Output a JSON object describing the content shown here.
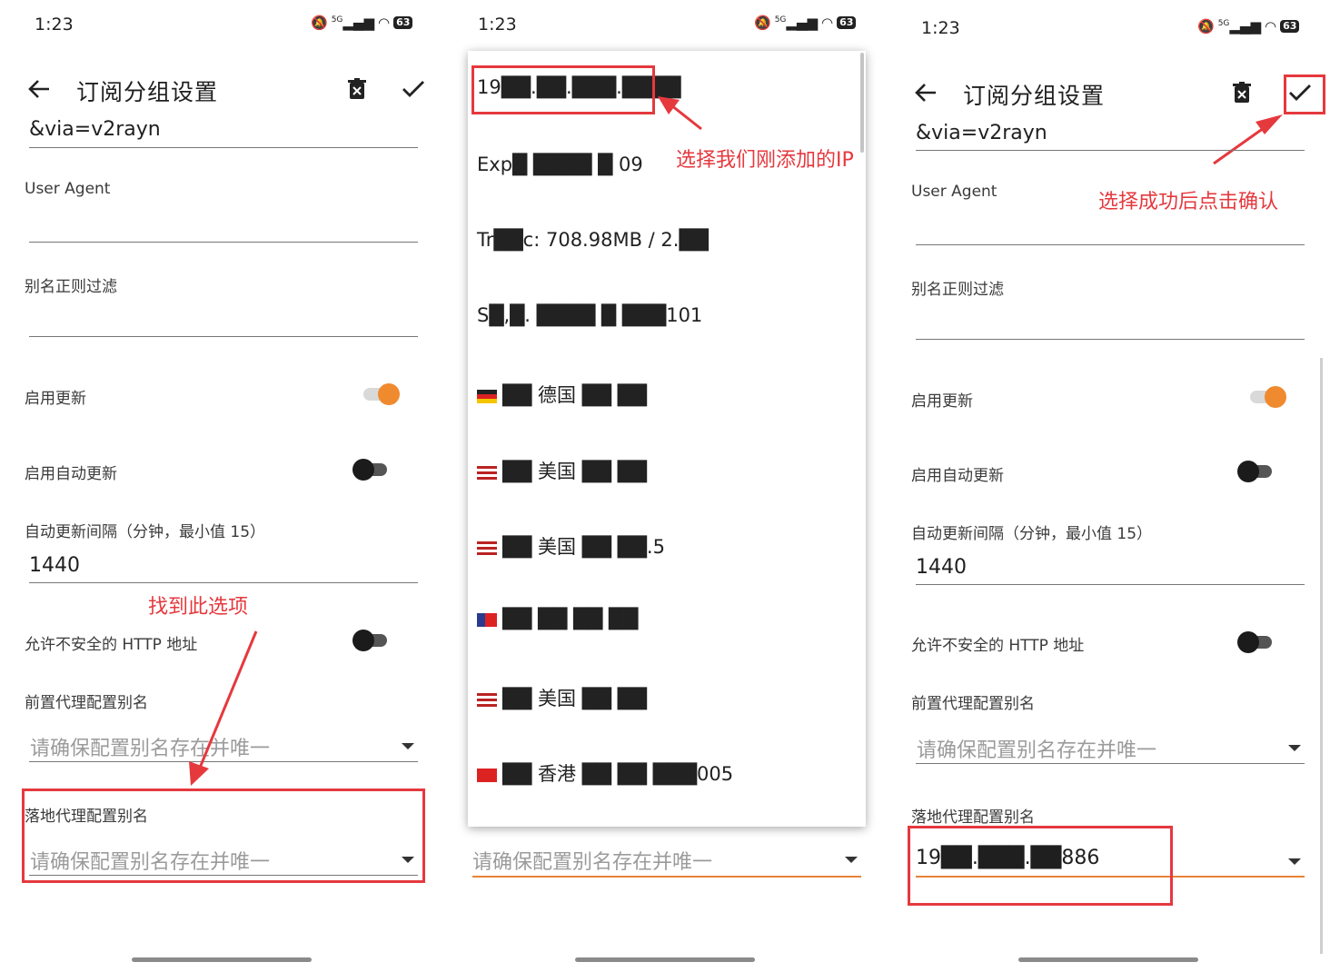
{
  "status": {
    "time": "1:23",
    "signal": "5G",
    "battery": "63"
  },
  "appbar": {
    "title": "订阅分组设置"
  },
  "form": {
    "url_tail": "&via=v2rayn",
    "user_agent_label": "User Agent",
    "alias_filter_label": "别名正则过滤",
    "enable_update_label": "启用更新",
    "enable_update": true,
    "auto_update_label": "启用自动更新",
    "auto_update": false,
    "interval_label": "自动更新间隔（分钟，最小值 15）",
    "interval_value": "1440",
    "insecure_http_label": "允许不安全的 HTTP 地址",
    "insecure_http": false,
    "prev_proxy_label": "前置代理配置别名",
    "prev_proxy_placeholder": "请确保配置别名存在并唯一",
    "next_proxy_label": "落地代理配置别名",
    "next_proxy_placeholder": "请确保配置别名存在并唯一",
    "next_proxy_selected": "19██.███.██886"
  },
  "popup": {
    "items": [
      "19██.██.███.████",
      "Exp█ ████ █ 09",
      "Tr██c: 708.98MB / 2.██",
      "S█,█. ████ █ ███101",
      "██ 德国 ██ ██",
      "██ 美国 ██ ██",
      "██ 美国 ██ ██.5",
      "██ ██ ██ ██",
      "██ 美国 ██ ██",
      "██ 香港 ██ ██ ███005"
    ]
  },
  "annotations": {
    "find_option": "找到此选项",
    "choose_ip": "选择我们刚添加的IP",
    "confirm": "选择成功后点击确认"
  },
  "colors": {
    "accent": "#f08a2e",
    "annotation": "#e5393e"
  },
  "icons": [
    "back-arrow-icon",
    "delete-icon",
    "check-icon",
    "dropdown-arrow-icon",
    "mute-icon",
    "wifi-icon",
    "signal-icon",
    "battery-icon"
  ]
}
